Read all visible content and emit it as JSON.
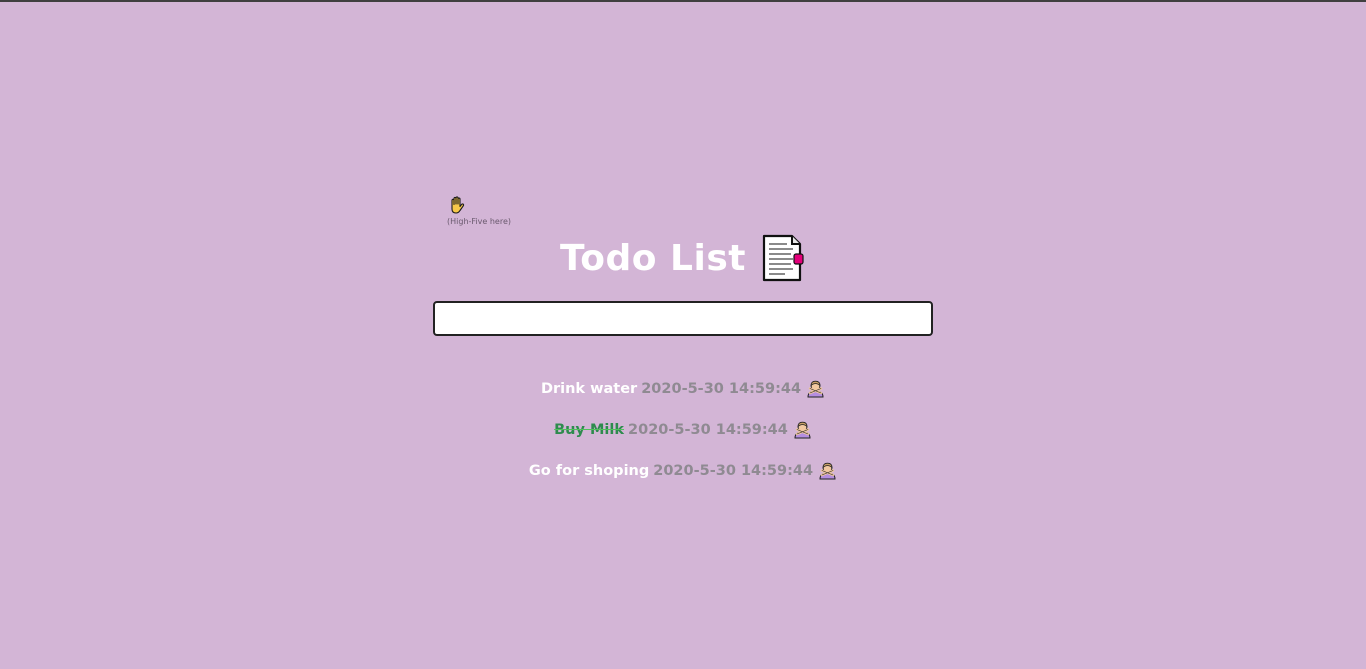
{
  "high_five": {
    "icon": "raised-hand-icon",
    "hint": "(High-Five here)"
  },
  "header": {
    "title": "Todo List",
    "icon": "document-icon"
  },
  "input": {
    "value": "",
    "placeholder": ""
  },
  "todos": [
    {
      "text": "Drink water",
      "date": "2020-5-30 14:59:44",
      "done": false,
      "delete_icon": "person-gesturing-no-icon"
    },
    {
      "text": "Buy Milk",
      "date": "2020-5-30 14:59:44",
      "done": true,
      "delete_icon": "person-gesturing-no-icon"
    },
    {
      "text": "Go for shoping",
      "date": "2020-5-30 14:59:44",
      "done": false,
      "delete_icon": "person-gesturing-no-icon"
    }
  ],
  "colors": {
    "background": "#d3b5d6",
    "title": "#ffffff",
    "date": "#8f8a92",
    "done_text": "#2e8b4e",
    "strike": "#4fc25b"
  }
}
